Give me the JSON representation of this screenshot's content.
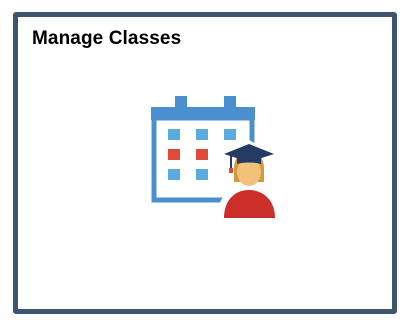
{
  "tile": {
    "title": "Manage Classes",
    "icon": "calendar-with-student-icon",
    "colors": {
      "border": "#3e5570",
      "calendar_blue": "#4a90d0",
      "cell_blue": "#5aacdf",
      "cell_red": "#e04a3a",
      "cap_navy": "#243b63",
      "student_red": "#cc2e2a",
      "face_skin": "#f2c27a",
      "hair": "#d39a3f"
    }
  }
}
